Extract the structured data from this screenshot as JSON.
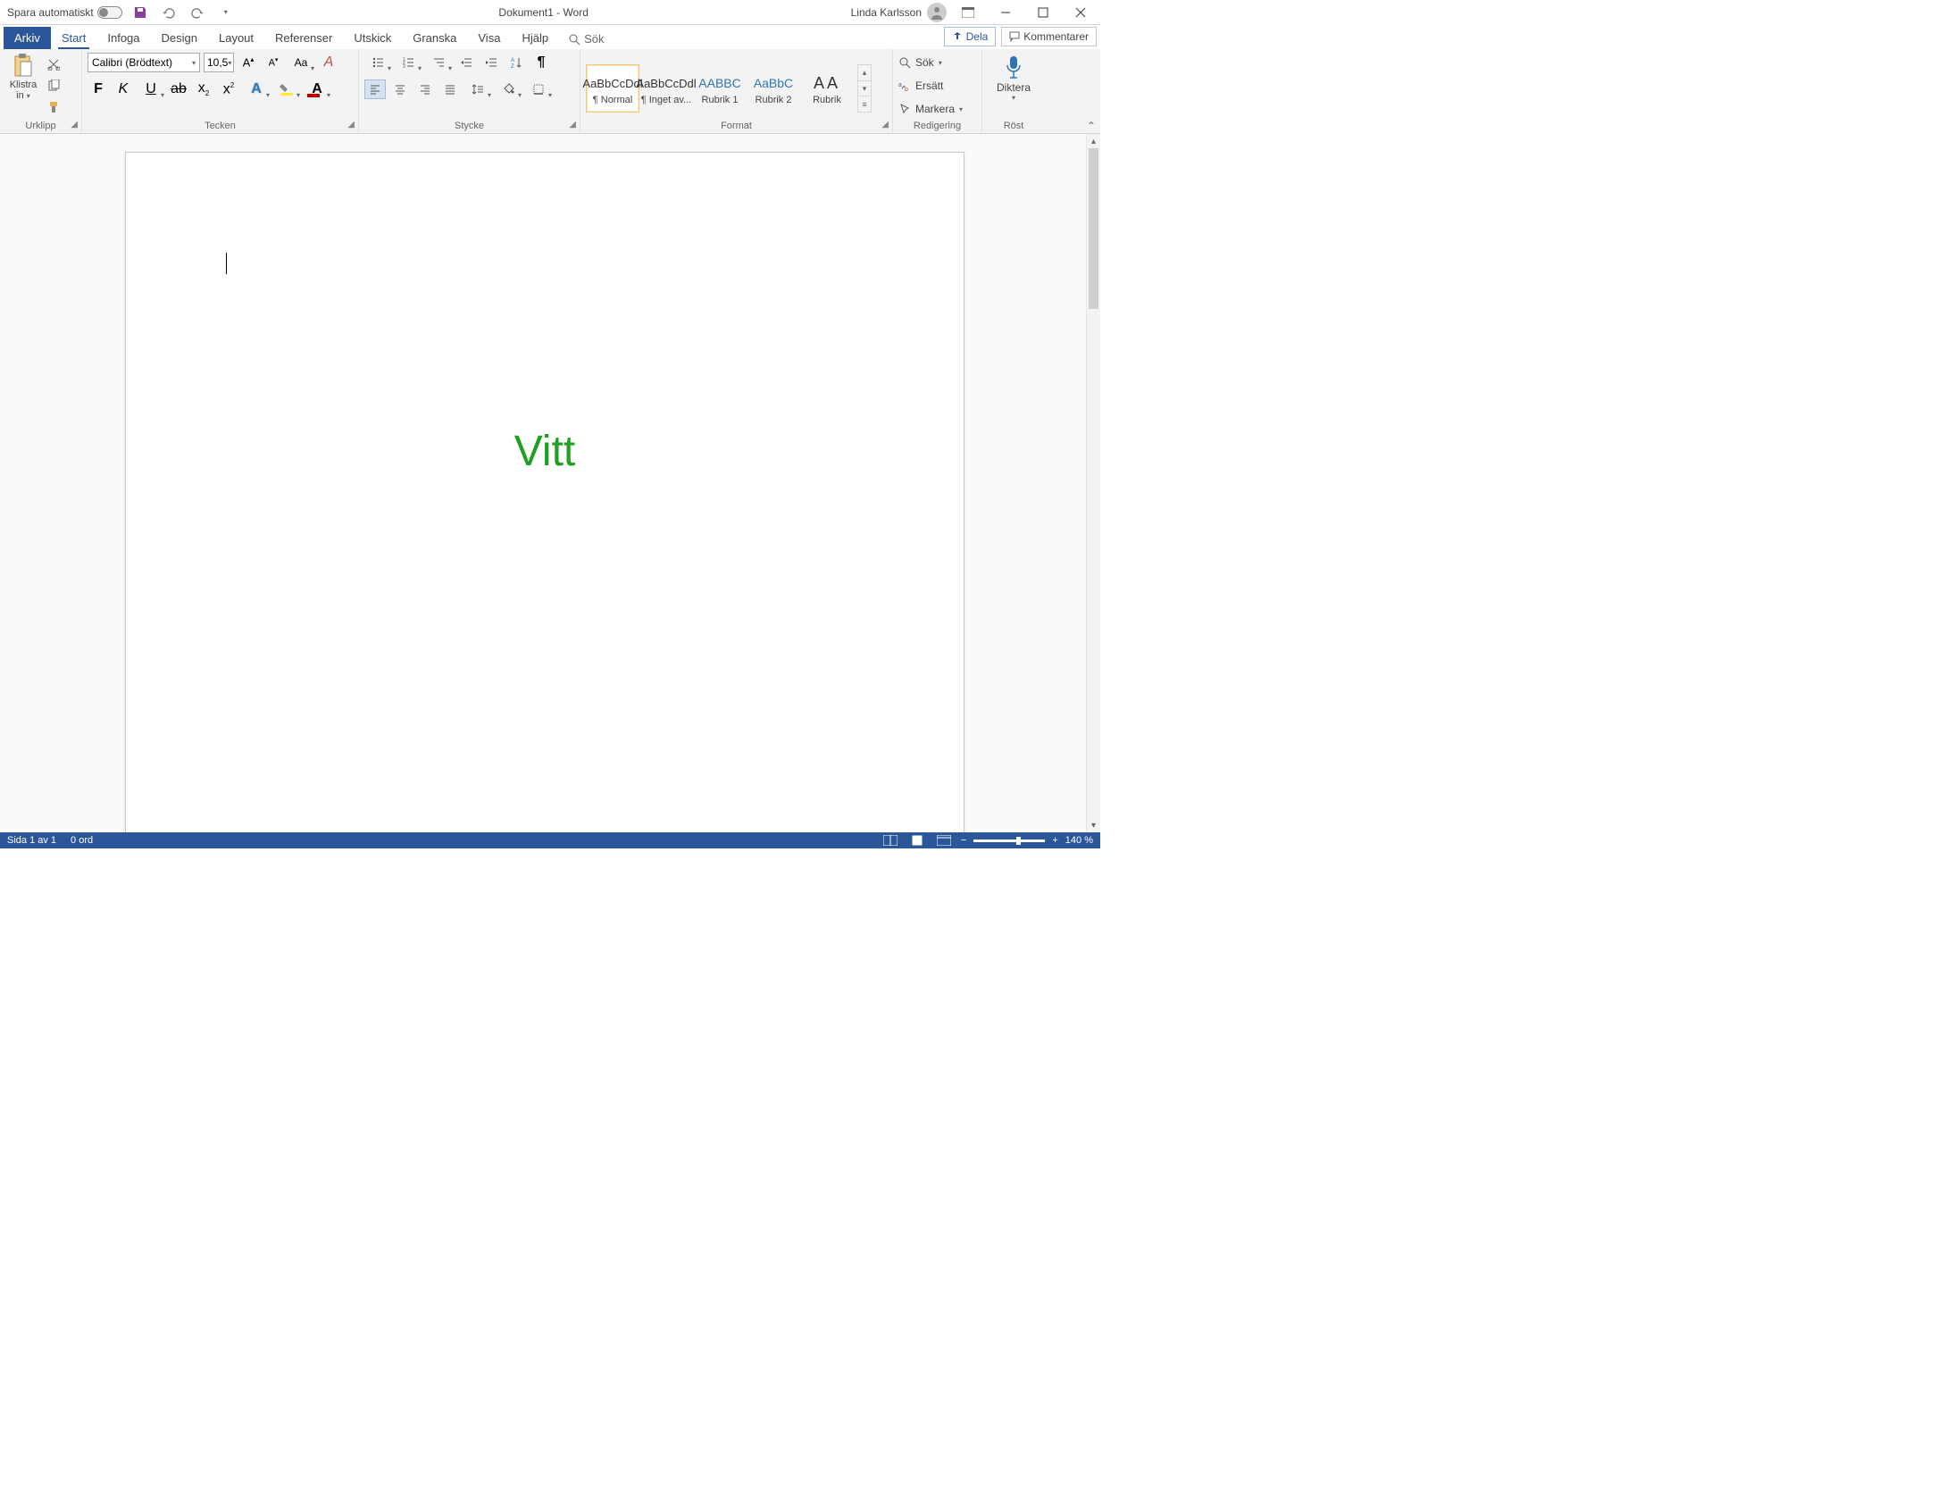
{
  "title_bar": {
    "autosave_label": "Spara automatiskt",
    "doc_title": "Dokument1  -  Word",
    "user_name": "Linda Karlsson"
  },
  "tabs": {
    "file": "Arkiv",
    "items": [
      "Start",
      "Infoga",
      "Design",
      "Layout",
      "Referenser",
      "Utskick",
      "Granska",
      "Visa",
      "Hjälp"
    ],
    "active_index": 0,
    "search_placeholder": "Sök",
    "share": "Dela",
    "comments": "Kommentarer"
  },
  "ribbon": {
    "clipboard": {
      "paste_label": "Klistra",
      "paste_sub": "in",
      "group_label": "Urklipp"
    },
    "font": {
      "font_name": "Calibri (Brödtext)",
      "font_size": "10,5",
      "group_label": "Tecken"
    },
    "paragraph": {
      "group_label": "Stycke"
    },
    "styles": {
      "items": [
        {
          "preview": "AaBbCcDdl",
          "label": "¶ Normal",
          "cls": ""
        },
        {
          "preview": "AaBbCcDdl",
          "label": "¶ Inget av...",
          "cls": ""
        },
        {
          "preview": "AABBC",
          "label": "Rubrik 1",
          "cls": "h1"
        },
        {
          "preview": "AaBbC",
          "label": "Rubrik 2",
          "cls": "h2"
        },
        {
          "preview": "AA",
          "label": "Rubrik",
          "cls": "title"
        }
      ],
      "group_label": "Format"
    },
    "editing": {
      "find": "Sök",
      "replace": "Ersätt",
      "select": "Markera",
      "group_label": "Redigering"
    },
    "voice": {
      "dictate": "Diktera",
      "group_label": "Röst"
    }
  },
  "document": {
    "watermark_text": "Vitt"
  },
  "status": {
    "page_info": "Sida 1 av 1",
    "word_count": "0 ord",
    "zoom_pct": "140 %"
  }
}
